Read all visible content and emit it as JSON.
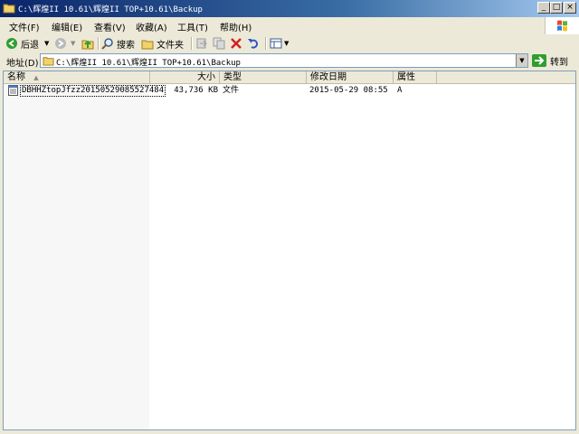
{
  "window": {
    "title": "C:\\辉煌II 10.61\\辉煌II TOP+10.61\\Backup",
    "controls": {
      "minimize": "_",
      "maximize": "□",
      "close": "×"
    }
  },
  "menu": [
    {
      "label": "文件(F)"
    },
    {
      "label": "编辑(E)"
    },
    {
      "label": "查看(V)"
    },
    {
      "label": "收藏(A)"
    },
    {
      "label": "工具(T)"
    },
    {
      "label": "帮助(H)"
    }
  ],
  "toolbar": {
    "back_label": "后退",
    "search_label": "搜索",
    "folders_label": "文件夹"
  },
  "address": {
    "label": "地址(D)",
    "value": "C:\\辉煌II 10.61\\辉煌II TOP+10.61\\Backup",
    "go_label": "转到"
  },
  "columns": {
    "name": "名称",
    "size": "大小",
    "type": "类型",
    "modified": "修改日期",
    "attributes": "属性"
  },
  "files": [
    {
      "name": "DBHHZtopJfzz20150529085527484",
      "size": "43,736 KB",
      "type": "文件",
      "modified": "2015-05-29 08:55",
      "attributes": "A"
    }
  ],
  "colors": {
    "title_start": "#0a246a",
    "title_end": "#a6caf0",
    "chrome": "#ece9d8",
    "go_arrow": "#2f9e2f",
    "delete_x": "#d42020"
  }
}
